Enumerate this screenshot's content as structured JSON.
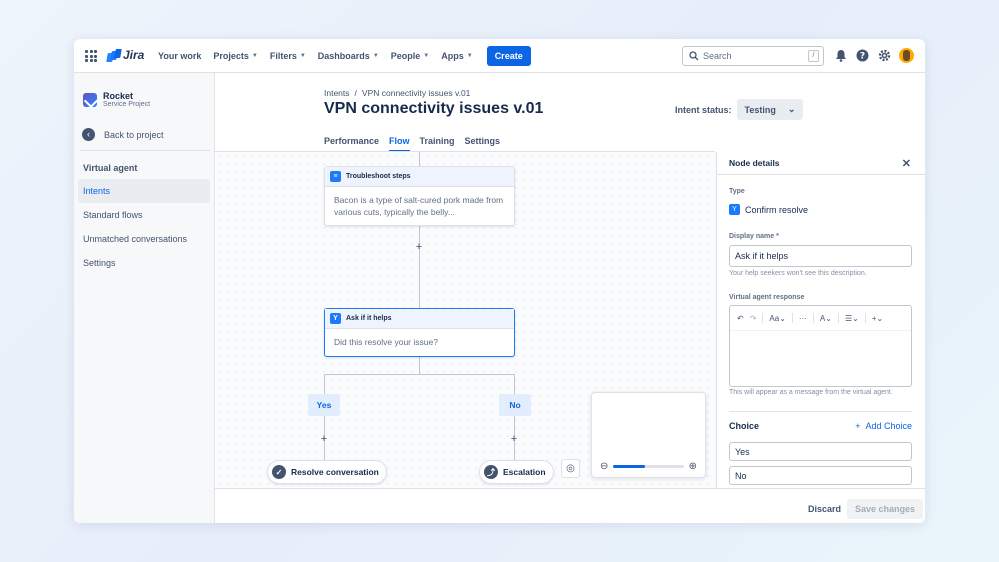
{
  "topnav": {
    "logo_text": "Jira",
    "items": [
      {
        "label": "Your work",
        "dropdown": false
      },
      {
        "label": "Projects",
        "dropdown": true
      },
      {
        "label": "Filters",
        "dropdown": true
      },
      {
        "label": "Dashboards",
        "dropdown": true
      },
      {
        "label": "People",
        "dropdown": true
      },
      {
        "label": "Apps",
        "dropdown": true
      }
    ],
    "create_label": "Create",
    "search_placeholder": "Search",
    "search_shortcut": "/"
  },
  "sidebar": {
    "project_name": "Rocket",
    "project_type": "Service Project",
    "back_label": "Back to project",
    "section_title": "Virtual agent",
    "items": [
      {
        "label": "Intents",
        "active": true
      },
      {
        "label": "Standard flows",
        "active": false
      },
      {
        "label": "Unmatched conversations",
        "active": false
      },
      {
        "label": "Settings",
        "active": false
      }
    ]
  },
  "header": {
    "breadcrumb": [
      "Intents",
      "/",
      "VPN connectivity issues v.01"
    ],
    "title": "VPN connectivity issues v.01",
    "intent_status_label": "Intent status:",
    "intent_status_value": "Testing"
  },
  "tabs": [
    {
      "label": "Performance",
      "active": false
    },
    {
      "label": "Flow",
      "active": true
    },
    {
      "label": "Training",
      "active": false
    },
    {
      "label": "Settings",
      "active": false
    }
  ],
  "flow": {
    "node1": {
      "title": "Troubleshoot steps",
      "body": "Bacon is a type of salt-cured pork made from various cuts, typically the belly..."
    },
    "node2": {
      "title": "Ask if it helps",
      "body": "Did this resolve your issue?"
    },
    "branch_yes": "Yes",
    "branch_no": "No",
    "end_yes": "Resolve conversation",
    "end_no": "Escalation",
    "zoom_level": 0.45
  },
  "panel": {
    "title": "Node details",
    "type_label": "Type",
    "type_value": "Confirm resolve",
    "display_name_label": "Display name *",
    "display_name_value": "Ask if it helps",
    "display_name_help": "Your help seekers won't see this description.",
    "response_label": "Virtual agent response",
    "response_help": "This will appear as a message from the virtual agent.",
    "choice_label": "Choice",
    "add_choice_label": "Add Choice",
    "choices": [
      "Yes",
      "No"
    ]
  },
  "footer": {
    "discard_label": "Discard",
    "save_label": "Save changes"
  },
  "colors": {
    "accent": "#0c66e4",
    "active_bg": "#e9ecf0",
    "branch_bg": "#e2edfd"
  }
}
